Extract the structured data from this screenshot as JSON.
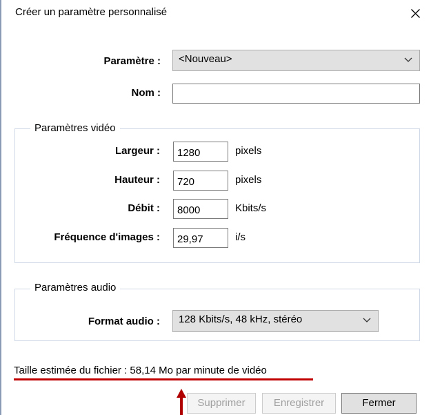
{
  "window": {
    "title": "Créer un paramètre personnalisé",
    "close_glyph": "×"
  },
  "preset": {
    "label": "Paramètre :",
    "selected": "<Nouveau>"
  },
  "name": {
    "label": "Nom :",
    "value": ""
  },
  "video": {
    "group_title": "Paramètres vidéo",
    "width_label": "Largeur :",
    "width_value": "1280",
    "width_unit": "pixels",
    "height_label": "Hauteur :",
    "height_value": "720",
    "height_unit": "pixels",
    "bitrate_label": "Débit :",
    "bitrate_value": "8000",
    "bitrate_unit": "Kbits/s",
    "framerate_label": "Fréquence d'images :",
    "framerate_value": "29,97",
    "framerate_unit": "i/s"
  },
  "audio": {
    "group_title": "Paramètres audio",
    "format_label": "Format audio :",
    "format_selected": "128 Kbits/s, 48 kHz, stéréo"
  },
  "estimate": {
    "text": "Taille estimée du fichier : 58,14 Mo par minute de vidéo"
  },
  "buttons": {
    "delete": "Supprimer",
    "save": "Enregistrer",
    "close": "Fermer"
  },
  "colors": {
    "annotation_red": "#c00000",
    "dialog_background": "#ffffff",
    "combo_background": "#e1e1e1",
    "groupbox_border": "#cfd8e6"
  },
  "icons": {
    "close": "close-icon",
    "dropdown": "chevron-down-icon",
    "annotation": "red-arrow-up-icon"
  }
}
